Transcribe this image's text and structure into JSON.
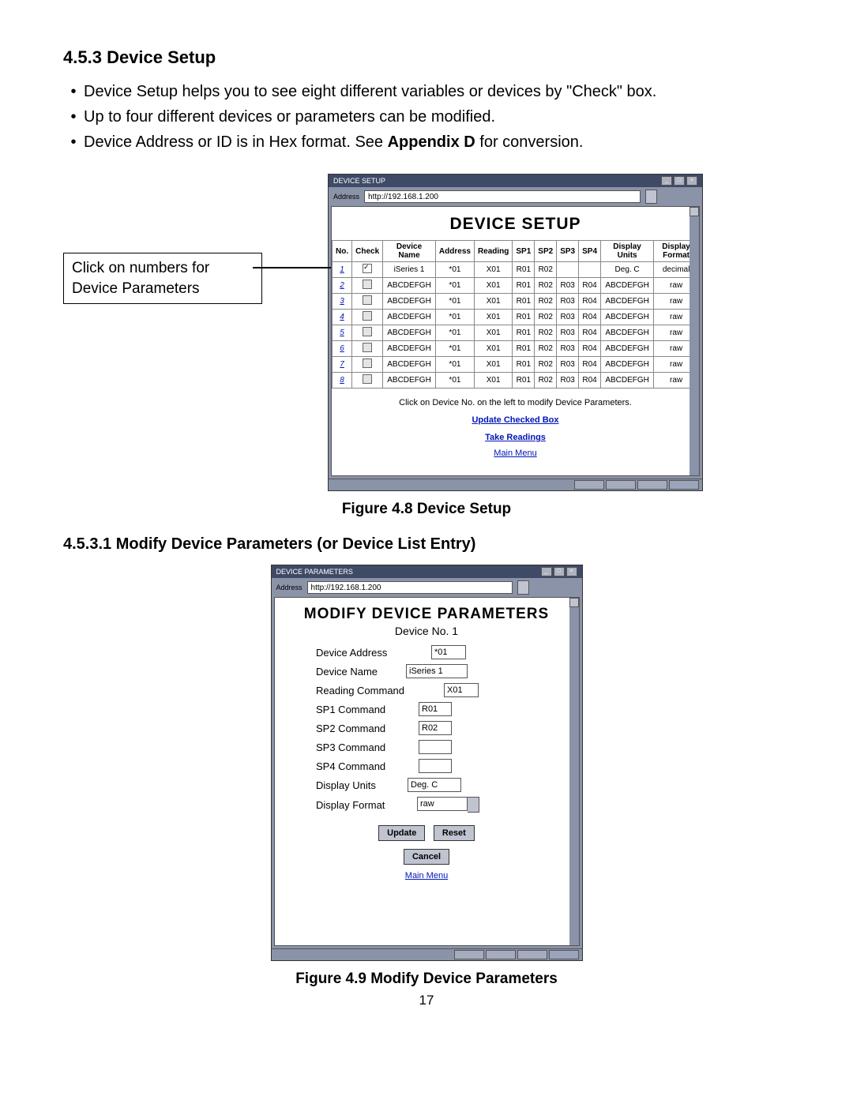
{
  "section": {
    "number": "4.5.3",
    "title": "Device Setup",
    "bullets": [
      "Device Setup helps you to see eight different variables or devices by \"Check\" box.",
      "Up to four different devices or parameters can be modified.",
      "Device Address or ID is in Hex format.  See "
    ],
    "bullet3_bold": "Appendix D",
    "bullet3_tail": " for conversion."
  },
  "callout": "Click on numbers for Device Parameters",
  "browser1": {
    "title": "DEVICE SETUP",
    "address_label": "Address",
    "address": "http://192.168.1.200",
    "page_title": "DEVICE SETUP",
    "headers": [
      "No.",
      "Check",
      "Device Name",
      "Address",
      "Reading",
      "SP1",
      "SP2",
      "SP3",
      "SP4",
      "Display Units",
      "Display Format"
    ],
    "rows": [
      {
        "no": "1",
        "checked": true,
        "name": "iSeries 1",
        "addr": "*01",
        "read": "X01",
        "sp1": "R01",
        "sp2": "R02",
        "sp3": "",
        "sp4": "",
        "units": "Deg. C",
        "fmt": "decimal"
      },
      {
        "no": "2",
        "checked": false,
        "name": "ABCDEFGH",
        "addr": "*01",
        "read": "X01",
        "sp1": "R01",
        "sp2": "R02",
        "sp3": "R03",
        "sp4": "R04",
        "units": "ABCDEFGH",
        "fmt": "raw"
      },
      {
        "no": "3",
        "checked": false,
        "name": "ABCDEFGH",
        "addr": "*01",
        "read": "X01",
        "sp1": "R01",
        "sp2": "R02",
        "sp3": "R03",
        "sp4": "R04",
        "units": "ABCDEFGH",
        "fmt": "raw"
      },
      {
        "no": "4",
        "checked": false,
        "name": "ABCDEFGH",
        "addr": "*01",
        "read": "X01",
        "sp1": "R01",
        "sp2": "R02",
        "sp3": "R03",
        "sp4": "R04",
        "units": "ABCDEFGH",
        "fmt": "raw"
      },
      {
        "no": "5",
        "checked": false,
        "name": "ABCDEFGH",
        "addr": "*01",
        "read": "X01",
        "sp1": "R01",
        "sp2": "R02",
        "sp3": "R03",
        "sp4": "R04",
        "units": "ABCDEFGH",
        "fmt": "raw"
      },
      {
        "no": "6",
        "checked": false,
        "name": "ABCDEFGH",
        "addr": "*01",
        "read": "X01",
        "sp1": "R01",
        "sp2": "R02",
        "sp3": "R03",
        "sp4": "R04",
        "units": "ABCDEFGH",
        "fmt": "raw"
      },
      {
        "no": "7",
        "checked": false,
        "name": "ABCDEFGH",
        "addr": "*01",
        "read": "X01",
        "sp1": "R01",
        "sp2": "R02",
        "sp3": "R03",
        "sp4": "R04",
        "units": "ABCDEFGH",
        "fmt": "raw"
      },
      {
        "no": "8",
        "checked": false,
        "name": "ABCDEFGH",
        "addr": "*01",
        "read": "X01",
        "sp1": "R01",
        "sp2": "R02",
        "sp3": "R03",
        "sp4": "R04",
        "units": "ABCDEFGH",
        "fmt": "raw"
      }
    ],
    "instruction": "Click on Device No. on the left to modify Device Parameters.",
    "update_link": "Update Checked Box",
    "take_link": "Take Readings",
    "main_link": "Main Menu"
  },
  "fig48": "Figure 4.8  Device Setup",
  "subsection": {
    "number": "4.5.3.1",
    "title": "Modify Device Parameters (or Device List Entry)"
  },
  "browser2": {
    "title": "DEVICE PARAMETERS",
    "address_label": "Address",
    "address": "http://192.168.1.200",
    "page_title": "MODIFY DEVICE PARAMETERS",
    "subtitle": "Device No. 1",
    "fields": {
      "device_address": {
        "label": "Device Address",
        "value": "*01"
      },
      "device_name": {
        "label": "Device Name",
        "value": "iSeries 1"
      },
      "reading_cmd": {
        "label": "Reading Command",
        "value": "X01"
      },
      "sp1": {
        "label": "SP1 Command",
        "value": "R01"
      },
      "sp2": {
        "label": "SP2 Command",
        "value": "R02"
      },
      "sp3": {
        "label": "SP3 Command",
        "value": ""
      },
      "sp4": {
        "label": "SP4 Command",
        "value": ""
      },
      "units": {
        "label": "Display Units",
        "value": "Deg. C"
      },
      "format": {
        "label": "Display Format",
        "value": "raw"
      }
    },
    "btn_update": "Update",
    "btn_reset": "Reset",
    "btn_cancel": "Cancel",
    "main_link": "Main Menu"
  },
  "fig49": "Figure 4.9  Modify Device Parameters",
  "page_number": "17"
}
